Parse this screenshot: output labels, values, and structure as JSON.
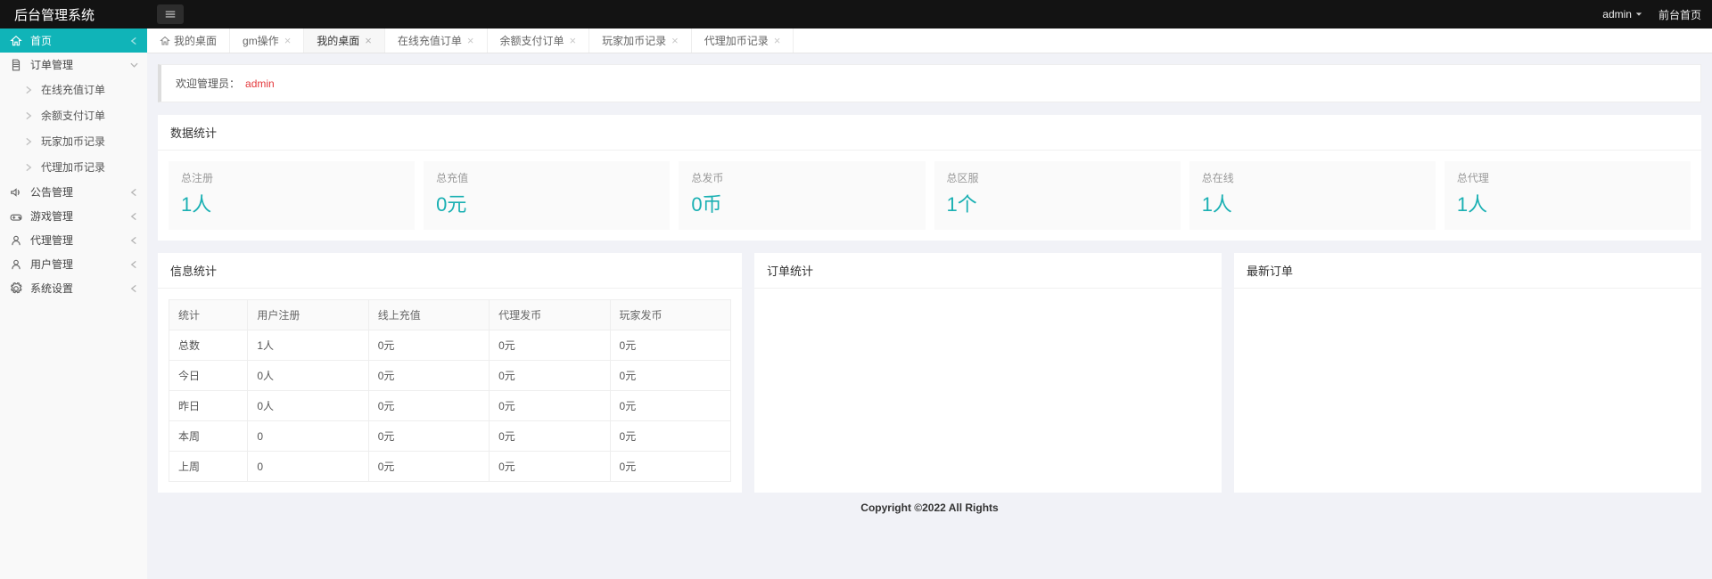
{
  "header": {
    "brand": "后台管理系统",
    "user": "admin",
    "frontend_link": "前台首页"
  },
  "sidebar": {
    "items": [
      {
        "label": "首页",
        "icon": "home",
        "active": true,
        "chev": "left"
      },
      {
        "label": "订单管理",
        "icon": "doc",
        "chev": "down",
        "children": [
          {
            "label": "在线充值订单"
          },
          {
            "label": "余额支付订单"
          },
          {
            "label": "玩家加币记录"
          },
          {
            "label": "代理加币记录"
          }
        ]
      },
      {
        "label": "公告管理",
        "icon": "speaker",
        "chev": "left"
      },
      {
        "label": "游戏管理",
        "icon": "game",
        "chev": "left"
      },
      {
        "label": "代理管理",
        "icon": "user",
        "chev": "left"
      },
      {
        "label": "用户管理",
        "icon": "user",
        "chev": "left"
      },
      {
        "label": "系统设置",
        "icon": "gear",
        "chev": "left"
      }
    ]
  },
  "tabs": [
    {
      "label": "我的桌面",
      "home": true,
      "closable": false
    },
    {
      "label": "gm操作",
      "closable": true
    },
    {
      "label": "我的桌面",
      "closable": true,
      "active": true
    },
    {
      "label": "在线充值订单",
      "closable": true
    },
    {
      "label": "余额支付订单",
      "closable": true
    },
    {
      "label": "玩家加币记录",
      "closable": true
    },
    {
      "label": "代理加币记录",
      "closable": true
    }
  ],
  "alert": {
    "prefix": "欢迎管理员：",
    "name": "admin"
  },
  "stats_panel": {
    "title": "数据统计",
    "cards": [
      {
        "label": "总注册",
        "value": "1人"
      },
      {
        "label": "总充值",
        "value": "0元"
      },
      {
        "label": "总发币",
        "value": "0币"
      },
      {
        "label": "总区服",
        "value": "1个"
      },
      {
        "label": "总在线",
        "value": "1人"
      },
      {
        "label": "总代理",
        "value": "1人"
      }
    ]
  },
  "info_panel": {
    "title": "信息统计",
    "headers": [
      "统计",
      "用户注册",
      "线上充值",
      "代理发币",
      "玩家发币"
    ],
    "rows": [
      [
        "总数",
        "1人",
        "0元",
        "0元",
        "0元"
      ],
      [
        "今日",
        "0人",
        "0元",
        "0元",
        "0元"
      ],
      [
        "昨日",
        "0人",
        "0元",
        "0元",
        "0元"
      ],
      [
        "本周",
        "0",
        "0元",
        "0元",
        "0元"
      ],
      [
        "上周",
        "0",
        "0元",
        "0元",
        "0元"
      ]
    ]
  },
  "order_stats_panel": {
    "title": "订单统计"
  },
  "latest_orders_panel": {
    "title": "最新订单"
  },
  "footer": "Copyright ©2022 All Rights"
}
